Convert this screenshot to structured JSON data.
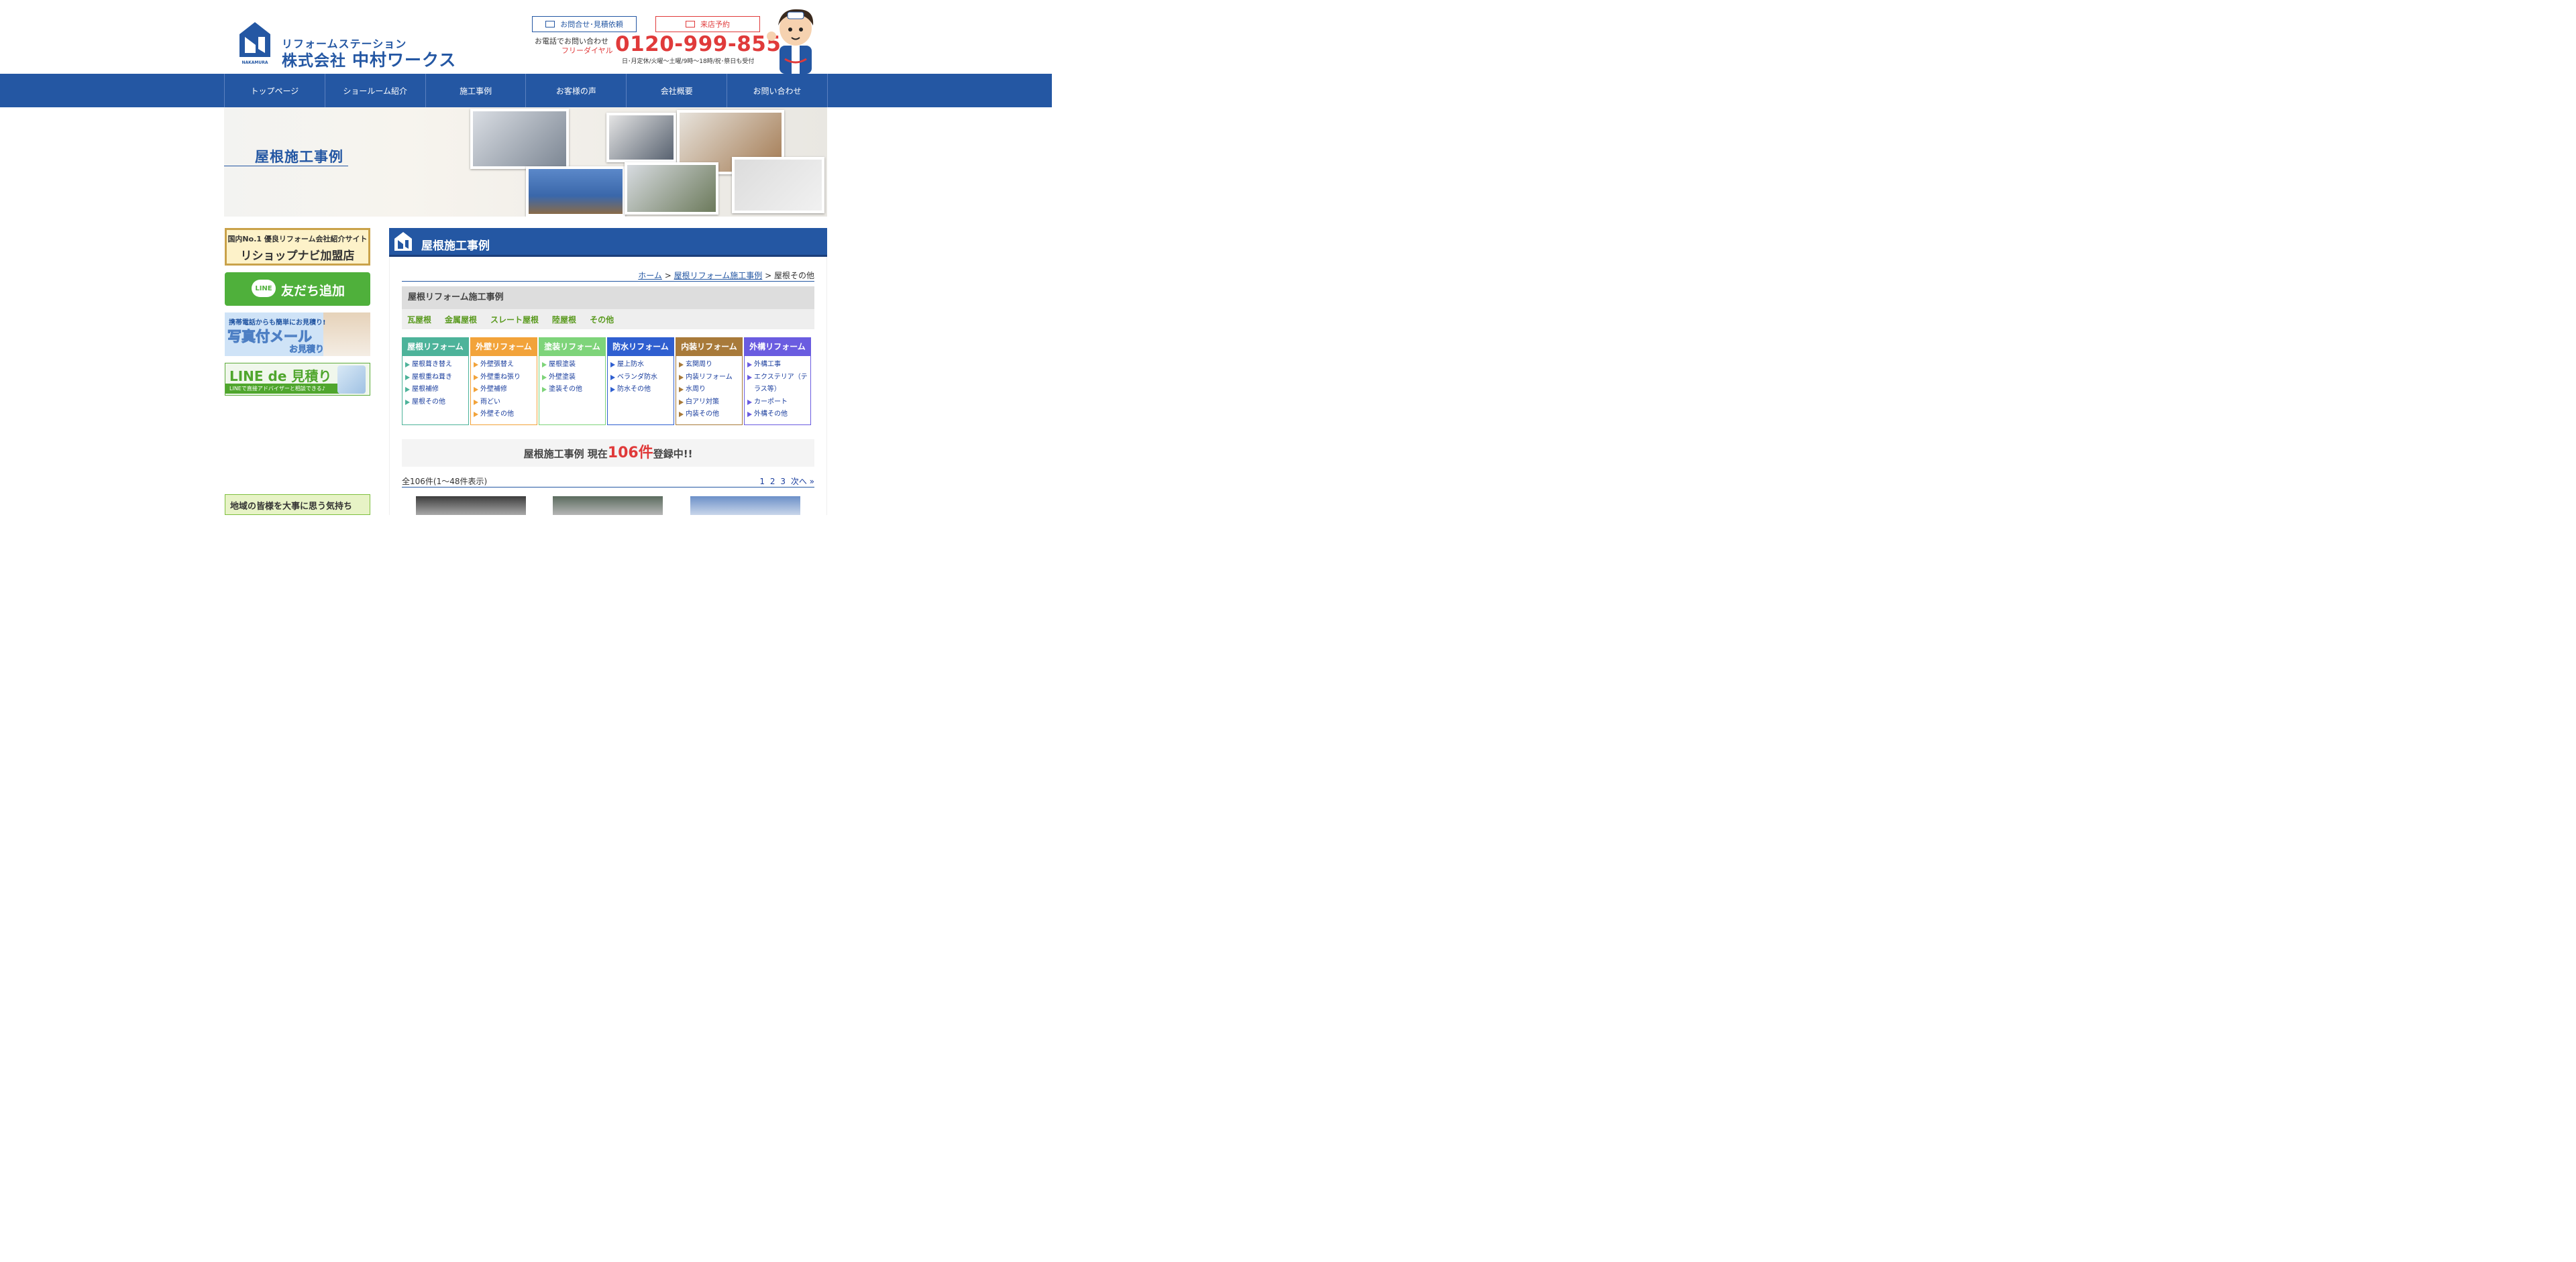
{
  "header": {
    "logo_sub": "リフォームステーション",
    "logo_company": "株式会社",
    "logo_name": "中村ワークス",
    "logo_mark_text": "NAKAMURA WORKS",
    "contact_button": "お問合せ･見積依頼",
    "visit_button": "来店予約",
    "phone_lead": "お電話でお問い合わせ",
    "phone_free": "フリーダイヤル",
    "phone_number": "0120-999-855",
    "hours": "日･月定休/火曜～土曜/9時～18時/祝･祭日も受付"
  },
  "nav": {
    "items": [
      "トップページ",
      "ショールーム紹介",
      "施工事例",
      "お客様の声",
      "会社概要",
      "お問い合わせ"
    ]
  },
  "hero": {
    "title": "屋根施工事例"
  },
  "sidebar": {
    "banner1_top": "国内No.1 優良リフォーム会社紹介サイト",
    "banner1_main": "リショップナビ加盟店",
    "banner2_bubble": "LINE",
    "banner2_text": "友だち追加",
    "banner3_top": "携帯電話からも簡単にお見積り!",
    "banner3_main": "写真付メール",
    "banner3_sub": "お見積り",
    "banner4_main": "LINE de 見積り",
    "banner4_sub": "LINEで直接アドバイザーと相談できる♪",
    "banner5_text": "地域の皆様を大事に思う気持ち"
  },
  "main": {
    "title": "屋根施工事例",
    "breadcrumb": {
      "home": "ホーム",
      "sep": ">",
      "parent": "屋根リフォーム施工事例",
      "current": "屋根その他"
    },
    "category_heading": "屋根リフォーム施工事例",
    "category_links": [
      "瓦屋根",
      "金属屋根",
      "スレート屋根",
      "陸屋根",
      "その他"
    ],
    "columns": [
      {
        "title": "屋根リフォーム",
        "color": "#4db39a",
        "items": [
          "屋根葺き替え",
          "屋根重ね葺き",
          "屋根補修",
          "屋根その他"
        ]
      },
      {
        "title": "外壁リフォーム",
        "color": "#f2a33a",
        "items": [
          "外壁張替え",
          "外壁重ね張り",
          "外壁補修",
          "雨どい",
          "外壁その他"
        ]
      },
      {
        "title": "塗装リフォーム",
        "color": "#7ed47a",
        "items": [
          "屋根塗装",
          "外壁塗装",
          "塗装その他"
        ]
      },
      {
        "title": "防水リフォーム",
        "color": "#2f5fd0",
        "items": [
          "屋上防水",
          "ベランダ防水",
          "防水その他"
        ]
      },
      {
        "title": "内装リフォーム",
        "color": "#a87a3a",
        "items": [
          "玄関周り",
          "内装リフォーム",
          "水周り",
          "白アリ対策",
          "内装その他"
        ]
      },
      {
        "title": "外構リフォーム",
        "color": "#6a5ce0",
        "items": [
          "外構工事",
          "エクステリア（テラス等）",
          "カーポート",
          "外構その他"
        ]
      }
    ],
    "count_prefix": "屋根施工事例 現在",
    "count_value": "106件",
    "count_suffix": "登録中!!",
    "total_text": "全106件(1～48件表示)",
    "pages": [
      "1",
      "2",
      "3",
      "次へ »"
    ]
  },
  "colors": {
    "brand": "#2457a3",
    "accent": "#e03a3a",
    "green": "#4fb03b"
  }
}
